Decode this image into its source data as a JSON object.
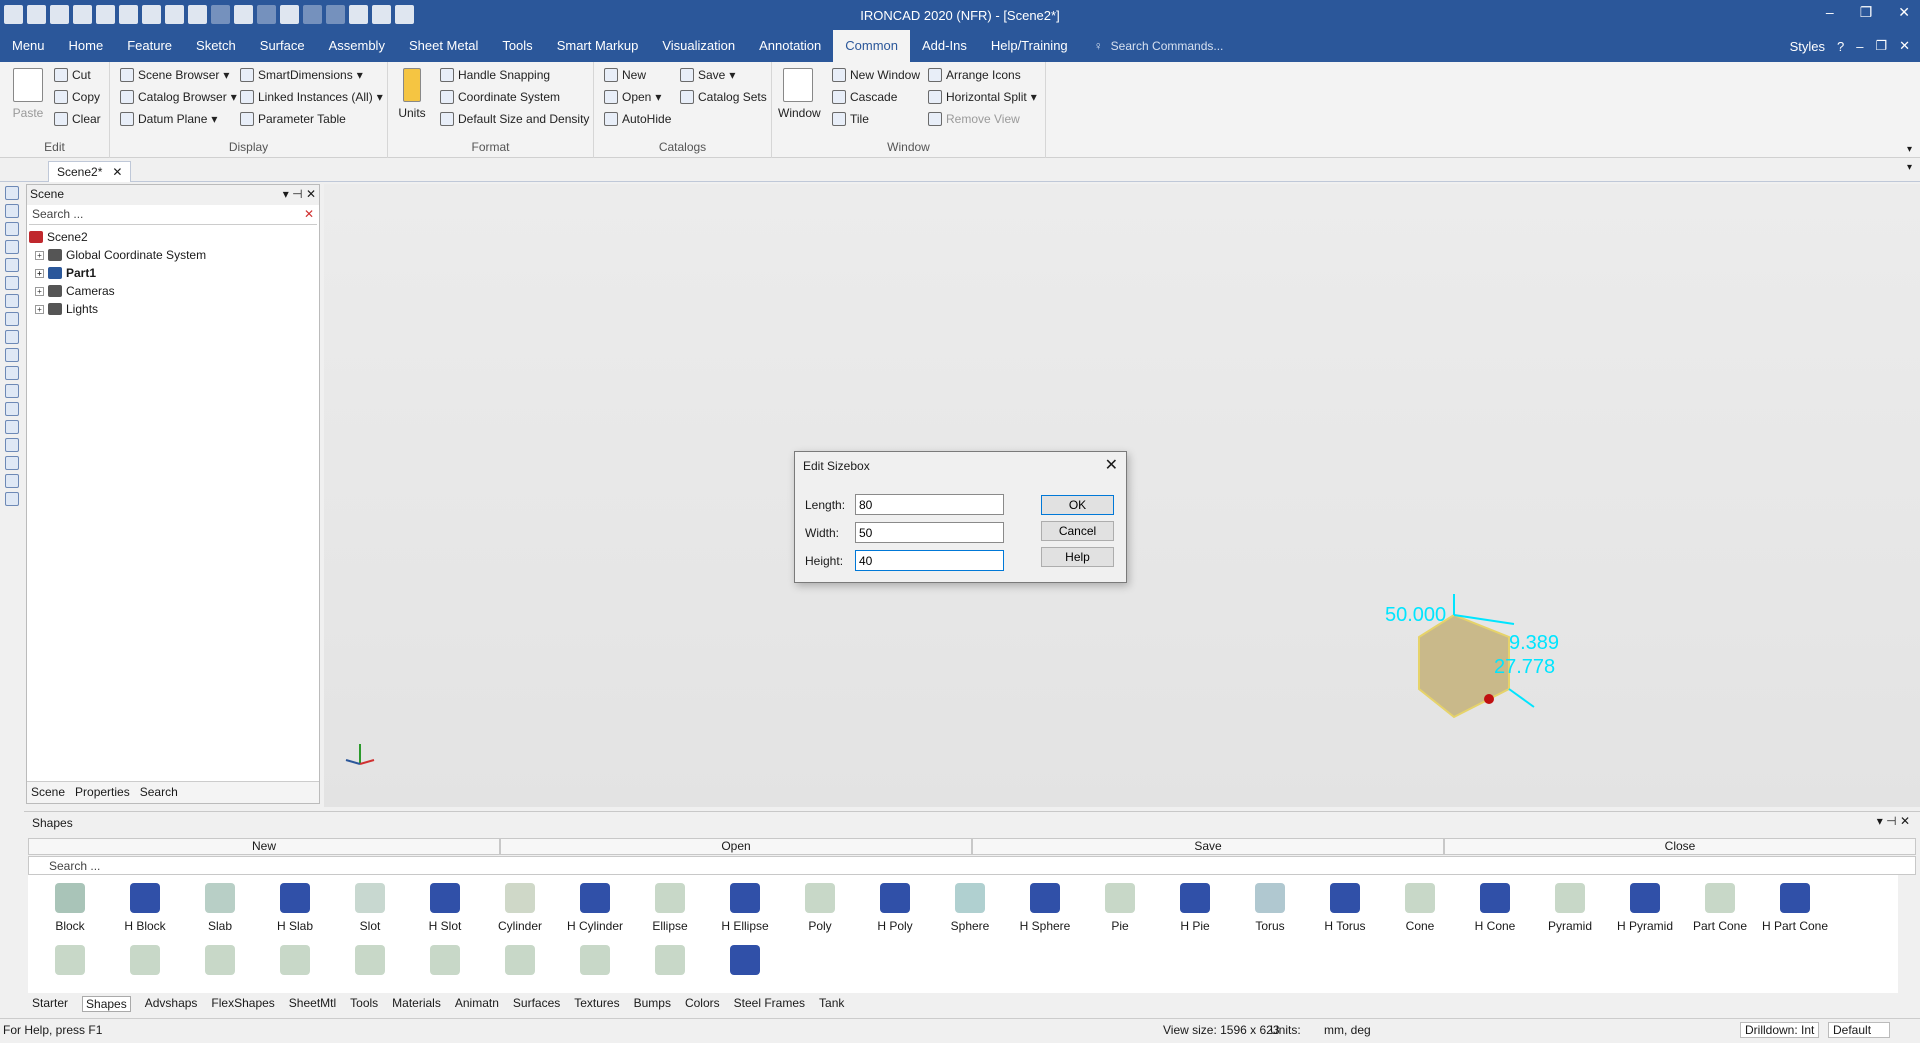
{
  "window": {
    "title": "IRONCAD 2020 (NFR) - [Scene2*]"
  },
  "menu": {
    "tabs": [
      "Menu",
      "Home",
      "Feature",
      "Sketch",
      "Surface",
      "Assembly",
      "Sheet Metal",
      "Tools",
      "Smart Markup",
      "Visualization",
      "Annotation",
      "Common",
      "Add-Ins",
      "Help/Training"
    ],
    "active": "Common",
    "search_placeholder": "Search Commands...",
    "styles": "Styles"
  },
  "ribbon": {
    "edit": {
      "paste": "Paste",
      "cut": "Cut",
      "copy": "Copy",
      "clear": "Clear",
      "label": "Edit"
    },
    "display": {
      "scene_browser": "Scene Browser",
      "catalog_browser": "Catalog Browser",
      "datum_plane": "Datum Plane",
      "smart_dimensions": "SmartDimensions",
      "linked_instances": "Linked Instances (All)",
      "parameter_table": "Parameter Table",
      "label": "Display"
    },
    "format": {
      "units": "Units",
      "handle_snapping": "Handle Snapping",
      "coordinate_system": "Coordinate System",
      "default_size": "Default Size and Density",
      "label": "Format"
    },
    "catalogs": {
      "new": "New",
      "open": "Open",
      "autohide": "AutoHide",
      "save": "Save",
      "catalog_sets": "Catalog Sets",
      "label": "Catalogs"
    },
    "window": {
      "window": "Window",
      "new_window": "New Window",
      "cascade": "Cascade",
      "tile": "Tile",
      "arrange_icons": "Arrange Icons",
      "horizontal_split": "Horizontal Split",
      "remove_view": "Remove View",
      "label": "Window"
    }
  },
  "doc_tab": "Scene2*",
  "scene_panel": {
    "title": "Scene",
    "search_placeholder": "Search ...",
    "nodes": [
      {
        "label": "Scene2"
      },
      {
        "label": "Global Coordinate System"
      },
      {
        "label": "Part1"
      },
      {
        "label": "Cameras"
      },
      {
        "label": "Lights"
      }
    ],
    "tabs": [
      "Scene",
      "Properties",
      "Search"
    ]
  },
  "viewport": {
    "dimensions": [
      "50.000",
      "9.389",
      "27.778"
    ]
  },
  "dialog": {
    "title": "Edit Sizebox",
    "length_label": "Length:",
    "length": "80",
    "width_label": "Width:",
    "width": "50",
    "height_label": "Height:",
    "height": "40",
    "ok": "OK",
    "cancel": "Cancel",
    "help": "Help"
  },
  "shapes": {
    "title": "Shapes",
    "commands": [
      "New",
      "Open",
      "Save",
      "Close"
    ],
    "search_placeholder": "Search ...",
    "items": [
      "Block",
      "H Block",
      "Slab",
      "H Slab",
      "Slot",
      "H Slot",
      "Cylinder",
      "H Cylinder",
      "Ellipse",
      "H Ellipse",
      "Poly",
      "H Poly",
      "Sphere",
      "H Sphere",
      "Pie",
      "H Pie",
      "Torus",
      "H Torus",
      "Cone",
      "H Cone",
      "Pyramid",
      "H Pyramid",
      "Part Cone",
      "H Part Cone"
    ],
    "categories": [
      "Starter",
      "Shapes",
      "Advshaps",
      "FlexShapes",
      "SheetMtl",
      "Tools",
      "Materials",
      "Animatn",
      "Surfaces",
      "Textures",
      "Bumps",
      "Colors",
      "Steel Frames",
      "Tank"
    ],
    "active_category": "Shapes"
  },
  "status": {
    "help": "For Help, press F1",
    "view_size": "View size: 1596 x  623",
    "units_label": "Units:",
    "units": "mm, deg",
    "drilldown": "Drilldown: Int",
    "mode": "Default"
  },
  "colors": {
    "accent": "#2b579a",
    "dim": "#00e5ff",
    "model": "#c9b98a"
  }
}
